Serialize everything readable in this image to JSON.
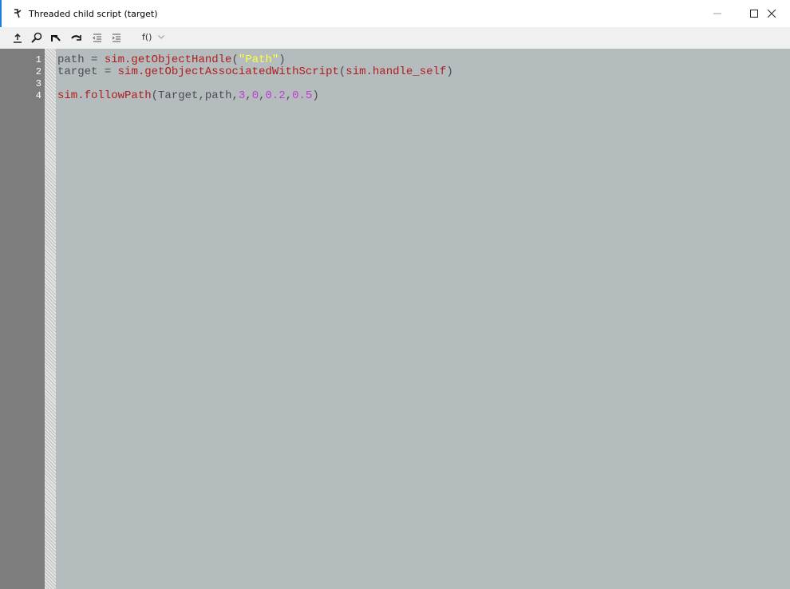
{
  "window": {
    "title": "Threaded child script (target)",
    "minimize_icon": "minimize-icon",
    "maximize_icon": "maximize-icon",
    "close_icon": "close-icon",
    "accent_color": "#1e7fd8"
  },
  "toolbar": {
    "icons": [
      "upload-icon",
      "search-icon",
      "undo-icon",
      "redo-icon",
      "outdent-icon",
      "indent-icon"
    ],
    "function_menu_label": "f()",
    "function_menu_chevron": "chevron-down-icon"
  },
  "editor": {
    "background": "#b4bcbd",
    "gutter_background": "#7d7d7d",
    "line_numbers": [
      "1",
      "2",
      "3",
      "4"
    ],
    "lines": [
      [
        {
          "t": "path",
          "k": "id"
        },
        {
          "t": " = ",
          "k": "op"
        },
        {
          "t": "sim.getObjectHandle",
          "k": "fn"
        },
        {
          "t": "(",
          "k": "op"
        },
        {
          "t": "\"Path\"",
          "k": "str"
        },
        {
          "t": ")",
          "k": "op"
        }
      ],
      [
        {
          "t": "target",
          "k": "id"
        },
        {
          "t": " = ",
          "k": "op"
        },
        {
          "t": "sim.getObjectAssociatedWithScript",
          "k": "fn"
        },
        {
          "t": "(",
          "k": "op"
        },
        {
          "t": "sim.handle_self",
          "k": "fn"
        },
        {
          "t": ")",
          "k": "op"
        }
      ],
      [],
      [
        {
          "t": "sim.followPath",
          "k": "fn"
        },
        {
          "t": "(",
          "k": "op"
        },
        {
          "t": "Target",
          "k": "id"
        },
        {
          "t": ",",
          "k": "op"
        },
        {
          "t": "path",
          "k": "id"
        },
        {
          "t": ",",
          "k": "op"
        },
        {
          "t": "3",
          "k": "num"
        },
        {
          "t": ",",
          "k": "op"
        },
        {
          "t": "0",
          "k": "num"
        },
        {
          "t": ",",
          "k": "op"
        },
        {
          "t": "0.2",
          "k": "num"
        },
        {
          "t": ",",
          "k": "op"
        },
        {
          "t": "0.5",
          "k": "num"
        },
        {
          "t": ")",
          "k": "op"
        }
      ]
    ],
    "token_colors": {
      "id": "#4f4a52",
      "op": "#4f4a52",
      "fn": "#b01d1d",
      "str": "#ffff3c",
      "num": "#c23ad8"
    }
  }
}
